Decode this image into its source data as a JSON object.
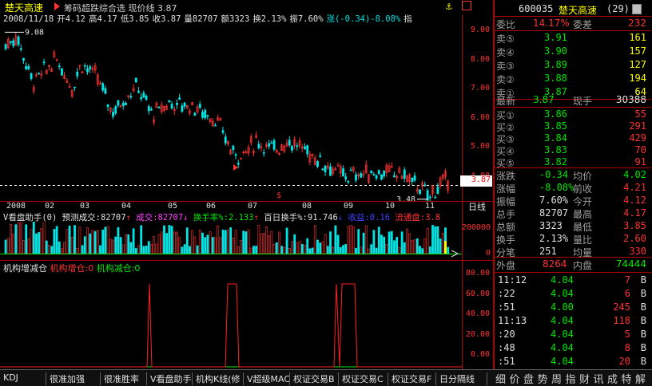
{
  "title": {
    "stock_name": "楚天高速",
    "indicator_label": "筹码超跌综合选 现价线 3.87"
  },
  "info": {
    "date": "2008/11/18",
    "open": "开4.12",
    "high": "高4.17",
    "low": "低3.85",
    "close": "收3.87",
    "volume": "量82707",
    "amount": "额3323",
    "turnover": "换2.13%",
    "amplitude": "振7.60%",
    "change": "涨(-0.34)-8.08%",
    "more": "指"
  },
  "price_axis": [
    "9.00",
    "8.00",
    "7.00",
    "6.00",
    "5.00",
    "4.00"
  ],
  "price_labels": {
    "high_mark": "9.08",
    "low_mark": "3.48",
    "current": "3.87"
  },
  "months": [
    "2008",
    "02",
    "03",
    "04",
    "05",
    "06",
    "07",
    "08",
    "09",
    "10",
    "11"
  ],
  "period_label": "日线",
  "vol_header": {
    "name": "V看盘助手(0)",
    "pred": "预测成交:82707",
    "vol": "成交:82707",
    "ratio": "换手率%:2.133",
    "day": "百日换手%:91.746",
    "profit": "收益:0.16",
    "float": "流通盘:3.8"
  },
  "vol_axis": [
    "200000",
    "0"
  ],
  "inst_header": {
    "name": "机构增减仓",
    "add": "机构增仓:0",
    "cut": "机构减仓:0"
  },
  "inst_axis": [
    "80.00",
    "60.00",
    "40.00",
    "20.00",
    "0.00"
  ],
  "quote": {
    "code": "600035",
    "name": "楚天高速",
    "rank": "(29)",
    "weibi_label": "委比",
    "weibi": "14.17%",
    "weicha_label": "委差",
    "weicha": "232",
    "asks": [
      {
        "label": "卖⑤",
        "price": "3.91",
        "vol": "161"
      },
      {
        "label": "卖④",
        "price": "3.90",
        "vol": "157"
      },
      {
        "label": "卖③",
        "price": "3.89",
        "vol": "127"
      },
      {
        "label": "卖②",
        "price": "3.88",
        "vol": "194"
      },
      {
        "label": "卖①",
        "price": "3.87",
        "vol": "64"
      }
    ],
    "last_label": "最新",
    "last": "3.87",
    "hand_label": "现手",
    "hand": "30388",
    "bids": [
      {
        "label": "买①",
        "price": "3.86",
        "vol": "55"
      },
      {
        "label": "买②",
        "price": "3.85",
        "vol": "291"
      },
      {
        "label": "买③",
        "price": "3.84",
        "vol": "429"
      },
      {
        "label": "买④",
        "price": "3.83",
        "vol": "70"
      },
      {
        "label": "买⑤",
        "price": "3.82",
        "vol": "91"
      }
    ],
    "stats": [
      {
        "l1": "涨跌",
        "v1": "-0.34",
        "l2": "均价",
        "v2": "4.02"
      },
      {
        "l1": "涨幅",
        "v1": "-8.08%",
        "l2": "前收",
        "v2": "4.21"
      },
      {
        "l1": "振幅",
        "v1": "7.60%",
        "l2": "今开",
        "v2": "4.12"
      },
      {
        "l1": "总手",
        "v1": "82707",
        "l2": "最高",
        "v2": "4.17"
      },
      {
        "l1": "总额",
        "v1": "3323",
        "l2": "最低",
        "v2": "3.85"
      },
      {
        "l1": "换手",
        "v1": "2.13%",
        "l2": "量比",
        "v2": "2.60"
      },
      {
        "l1": "分笔",
        "v1": "251",
        "l2": "均量",
        "v2": "330"
      }
    ],
    "outer_label": "外盘",
    "outer": "8264",
    "inner_label": "内盘",
    "inner": "74444",
    "ticks": [
      {
        "t": "11:12",
        "p": "4.04",
        "v": "7",
        "s": "B"
      },
      {
        "t": ":22",
        "p": "4.04",
        "v": "6",
        "s": "B"
      },
      {
        "t": ":51",
        "p": "4.00",
        "v": "245",
        "s": "B"
      },
      {
        "t": "11:13",
        "p": "4.04",
        "v": "118",
        "s": "B"
      },
      {
        "t": ":20",
        "p": "4.04",
        "v": "5",
        "s": "B"
      },
      {
        "t": ":48",
        "p": "4.04",
        "v": "8",
        "s": "B"
      },
      {
        "t": ":51",
        "p": "4.04",
        "v": "20",
        "s": "B"
      }
    ]
  },
  "tabs": [
    "KDJ",
    "很准加强",
    "很准胜率",
    "V看盘助手",
    "机构K线(修",
    "V超级MACD",
    "权证交易B",
    "权证交易C",
    "权证交易F",
    "日分隔线",
    "细",
    "价",
    "盘",
    "势",
    "周",
    "指",
    "财",
    "讯",
    "成",
    "特",
    "解"
  ]
}
